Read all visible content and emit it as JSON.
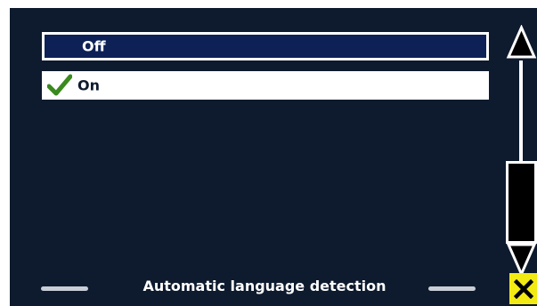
{
  "dialog": {
    "title": "Automatic language detection",
    "options": [
      {
        "label": "Off",
        "selected": false,
        "checked": false
      },
      {
        "label": "On",
        "selected": true,
        "checked": true
      }
    ]
  },
  "icons": {
    "check": "checkmark-icon",
    "scroll_up": "arrow-up-icon",
    "scroll_down": "arrow-down-icon",
    "close": "close-icon"
  },
  "colors": {
    "background": "#0e1b2e",
    "highlight": "#0d2156",
    "check": "#3a8a1e",
    "close_button": "#f2ea13"
  }
}
